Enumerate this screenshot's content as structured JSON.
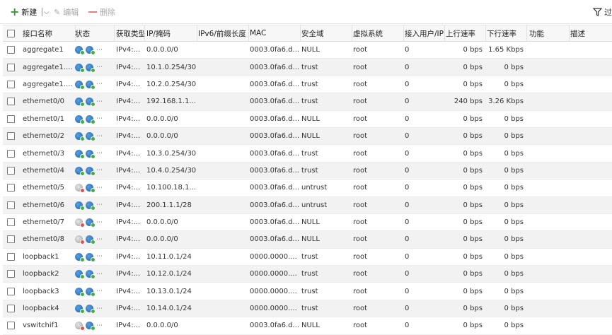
{
  "toolbar": {
    "new_label": "新建",
    "edit_label": "编辑",
    "delete_label": "删除",
    "filter_label": "过"
  },
  "columns": [
    "接口名称",
    "状态",
    "获取类型",
    "IP/掩码",
    "IPv6/前缀长度",
    "MAC",
    "安全域",
    "虚拟系统",
    "接入用户/IP",
    "上行速率",
    "下行速率",
    "功能",
    "描述"
  ],
  "rows": [
    {
      "name": "aggregate1",
      "status": [
        "on",
        "on"
      ],
      "type": "IPv4:...",
      "ip": "0.0.0.0/0",
      "mac": "0003.0fa6.d...",
      "zone": "NULL",
      "vsys": "root",
      "users": "0",
      "up": "0 bps",
      "down": "1.65 Kbps"
    },
    {
      "name": "aggregate1....",
      "status": [
        "on",
        "on"
      ],
      "type": "IPv4:...",
      "ip": "10.1.0.254/30",
      "mac": "0003.0fa6.d...",
      "zone": "trust",
      "vsys": "root",
      "users": "0",
      "up": "0 bps",
      "down": "0 bps"
    },
    {
      "name": "aggregate1....",
      "status": [
        "on",
        "on"
      ],
      "type": "IPv4:...",
      "ip": "10.2.0.254/30",
      "mac": "0003.0fa6.d...",
      "zone": "trust",
      "vsys": "root",
      "users": "0",
      "up": "0 bps",
      "down": "0 bps"
    },
    {
      "name": "ethernet0/0",
      "status": [
        "on",
        "on"
      ],
      "type": "IPv4:...",
      "ip": "192.168.1.1....",
      "mac": "0003.0fa6.d...",
      "zone": "trust",
      "vsys": "root",
      "users": "0",
      "up": "240 bps",
      "down": "3.26 Kbps"
    },
    {
      "name": "ethernet0/1",
      "status": [
        "on",
        "on"
      ],
      "type": "IPv4:...",
      "ip": "0.0.0.0/0",
      "mac": "0003.0fa6.d...",
      "zone": "NULL",
      "vsys": "root",
      "users": "0",
      "up": "0 bps",
      "down": "0 bps"
    },
    {
      "name": "ethernet0/2",
      "status": [
        "on",
        "on"
      ],
      "type": "IPv4:...",
      "ip": "0.0.0.0/0",
      "mac": "0003.0fa6.d...",
      "zone": "NULL",
      "vsys": "root",
      "users": "0",
      "up": "0 bps",
      "down": "0 bps"
    },
    {
      "name": "ethernet0/3",
      "status": [
        "on",
        "on"
      ],
      "type": "IPv4:...",
      "ip": "10.3.0.254/30",
      "mac": "0003.0fa6.d...",
      "zone": "trust",
      "vsys": "root",
      "users": "0",
      "up": "0 bps",
      "down": "0 bps"
    },
    {
      "name": "ethernet0/4",
      "status": [
        "on",
        "on"
      ],
      "type": "IPv4:...",
      "ip": "10.4.0.254/30",
      "mac": "0003.0fa6.d...",
      "zone": "trust",
      "vsys": "root",
      "users": "0",
      "up": "0 bps",
      "down": "0 bps"
    },
    {
      "name": "ethernet0/5",
      "status": [
        "off",
        "on"
      ],
      "type": "IPv4:...",
      "ip": "10.100.18.1....",
      "mac": "0003.0fa6.d...",
      "zone": "untrust",
      "vsys": "root",
      "users": "0",
      "up": "0 bps",
      "down": "0 bps"
    },
    {
      "name": "ethernet0/6",
      "status": [
        "on",
        "on"
      ],
      "type": "IPv4:...",
      "ip": "200.1.1.1/28",
      "mac": "0003.0fa6.d...",
      "zone": "untrust",
      "vsys": "root",
      "users": "0",
      "up": "0 bps",
      "down": "0 bps"
    },
    {
      "name": "ethernet0/7",
      "status": [
        "off",
        "on"
      ],
      "type": "IPv4:...",
      "ip": "0.0.0.0/0",
      "mac": "0003.0fa6.d...",
      "zone": "NULL",
      "vsys": "root",
      "users": "0",
      "up": "0 bps",
      "down": "0 bps"
    },
    {
      "name": "ethernet0/8",
      "status": [
        "off",
        "on"
      ],
      "type": "IPv4:...",
      "ip": "0.0.0.0/0",
      "mac": "0003.0fa6.d...",
      "zone": "NULL",
      "vsys": "root",
      "users": "0",
      "up": "0 bps",
      "down": "0 bps"
    },
    {
      "name": "loopback1",
      "status": [
        "on",
        "on"
      ],
      "type": "IPv4:...",
      "ip": "10.11.0.1/24",
      "mac": "0000.0000....",
      "zone": "trust",
      "vsys": "root",
      "users": "0",
      "up": "0 bps",
      "down": "0 bps"
    },
    {
      "name": "loopback2",
      "status": [
        "on",
        "on"
      ],
      "type": "IPv4:...",
      "ip": "10.12.0.1/24",
      "mac": "0000.0000....",
      "zone": "trust",
      "vsys": "root",
      "users": "0",
      "up": "0 bps",
      "down": "0 bps"
    },
    {
      "name": "loopback3",
      "status": [
        "on",
        "on"
      ],
      "type": "IPv4:...",
      "ip": "10.13.0.1/24",
      "mac": "0000.0000....",
      "zone": "trust",
      "vsys": "root",
      "users": "0",
      "up": "0 bps",
      "down": "0 bps"
    },
    {
      "name": "loopback4",
      "status": [
        "on",
        "on"
      ],
      "type": "IPv4:...",
      "ip": "10.14.0.1/24",
      "mac": "0000.0000....",
      "zone": "trust",
      "vsys": "root",
      "users": "0",
      "up": "0 bps",
      "down": "0 bps"
    },
    {
      "name": "vswitchif1",
      "status": [
        "off",
        "on"
      ],
      "type": "IPv4:...",
      "ip": "0.0.0.0/0",
      "mac": "0003.0fa6.d...",
      "zone": "NULL",
      "vsys": "root",
      "users": "0",
      "up": "0 bps",
      "down": "0 bps"
    }
  ],
  "colors": {
    "accent_green": "#3a9a3a",
    "status_up": "#3cb043",
    "status_down": "#d9534f",
    "globe_blue": "#1d5fa8"
  }
}
